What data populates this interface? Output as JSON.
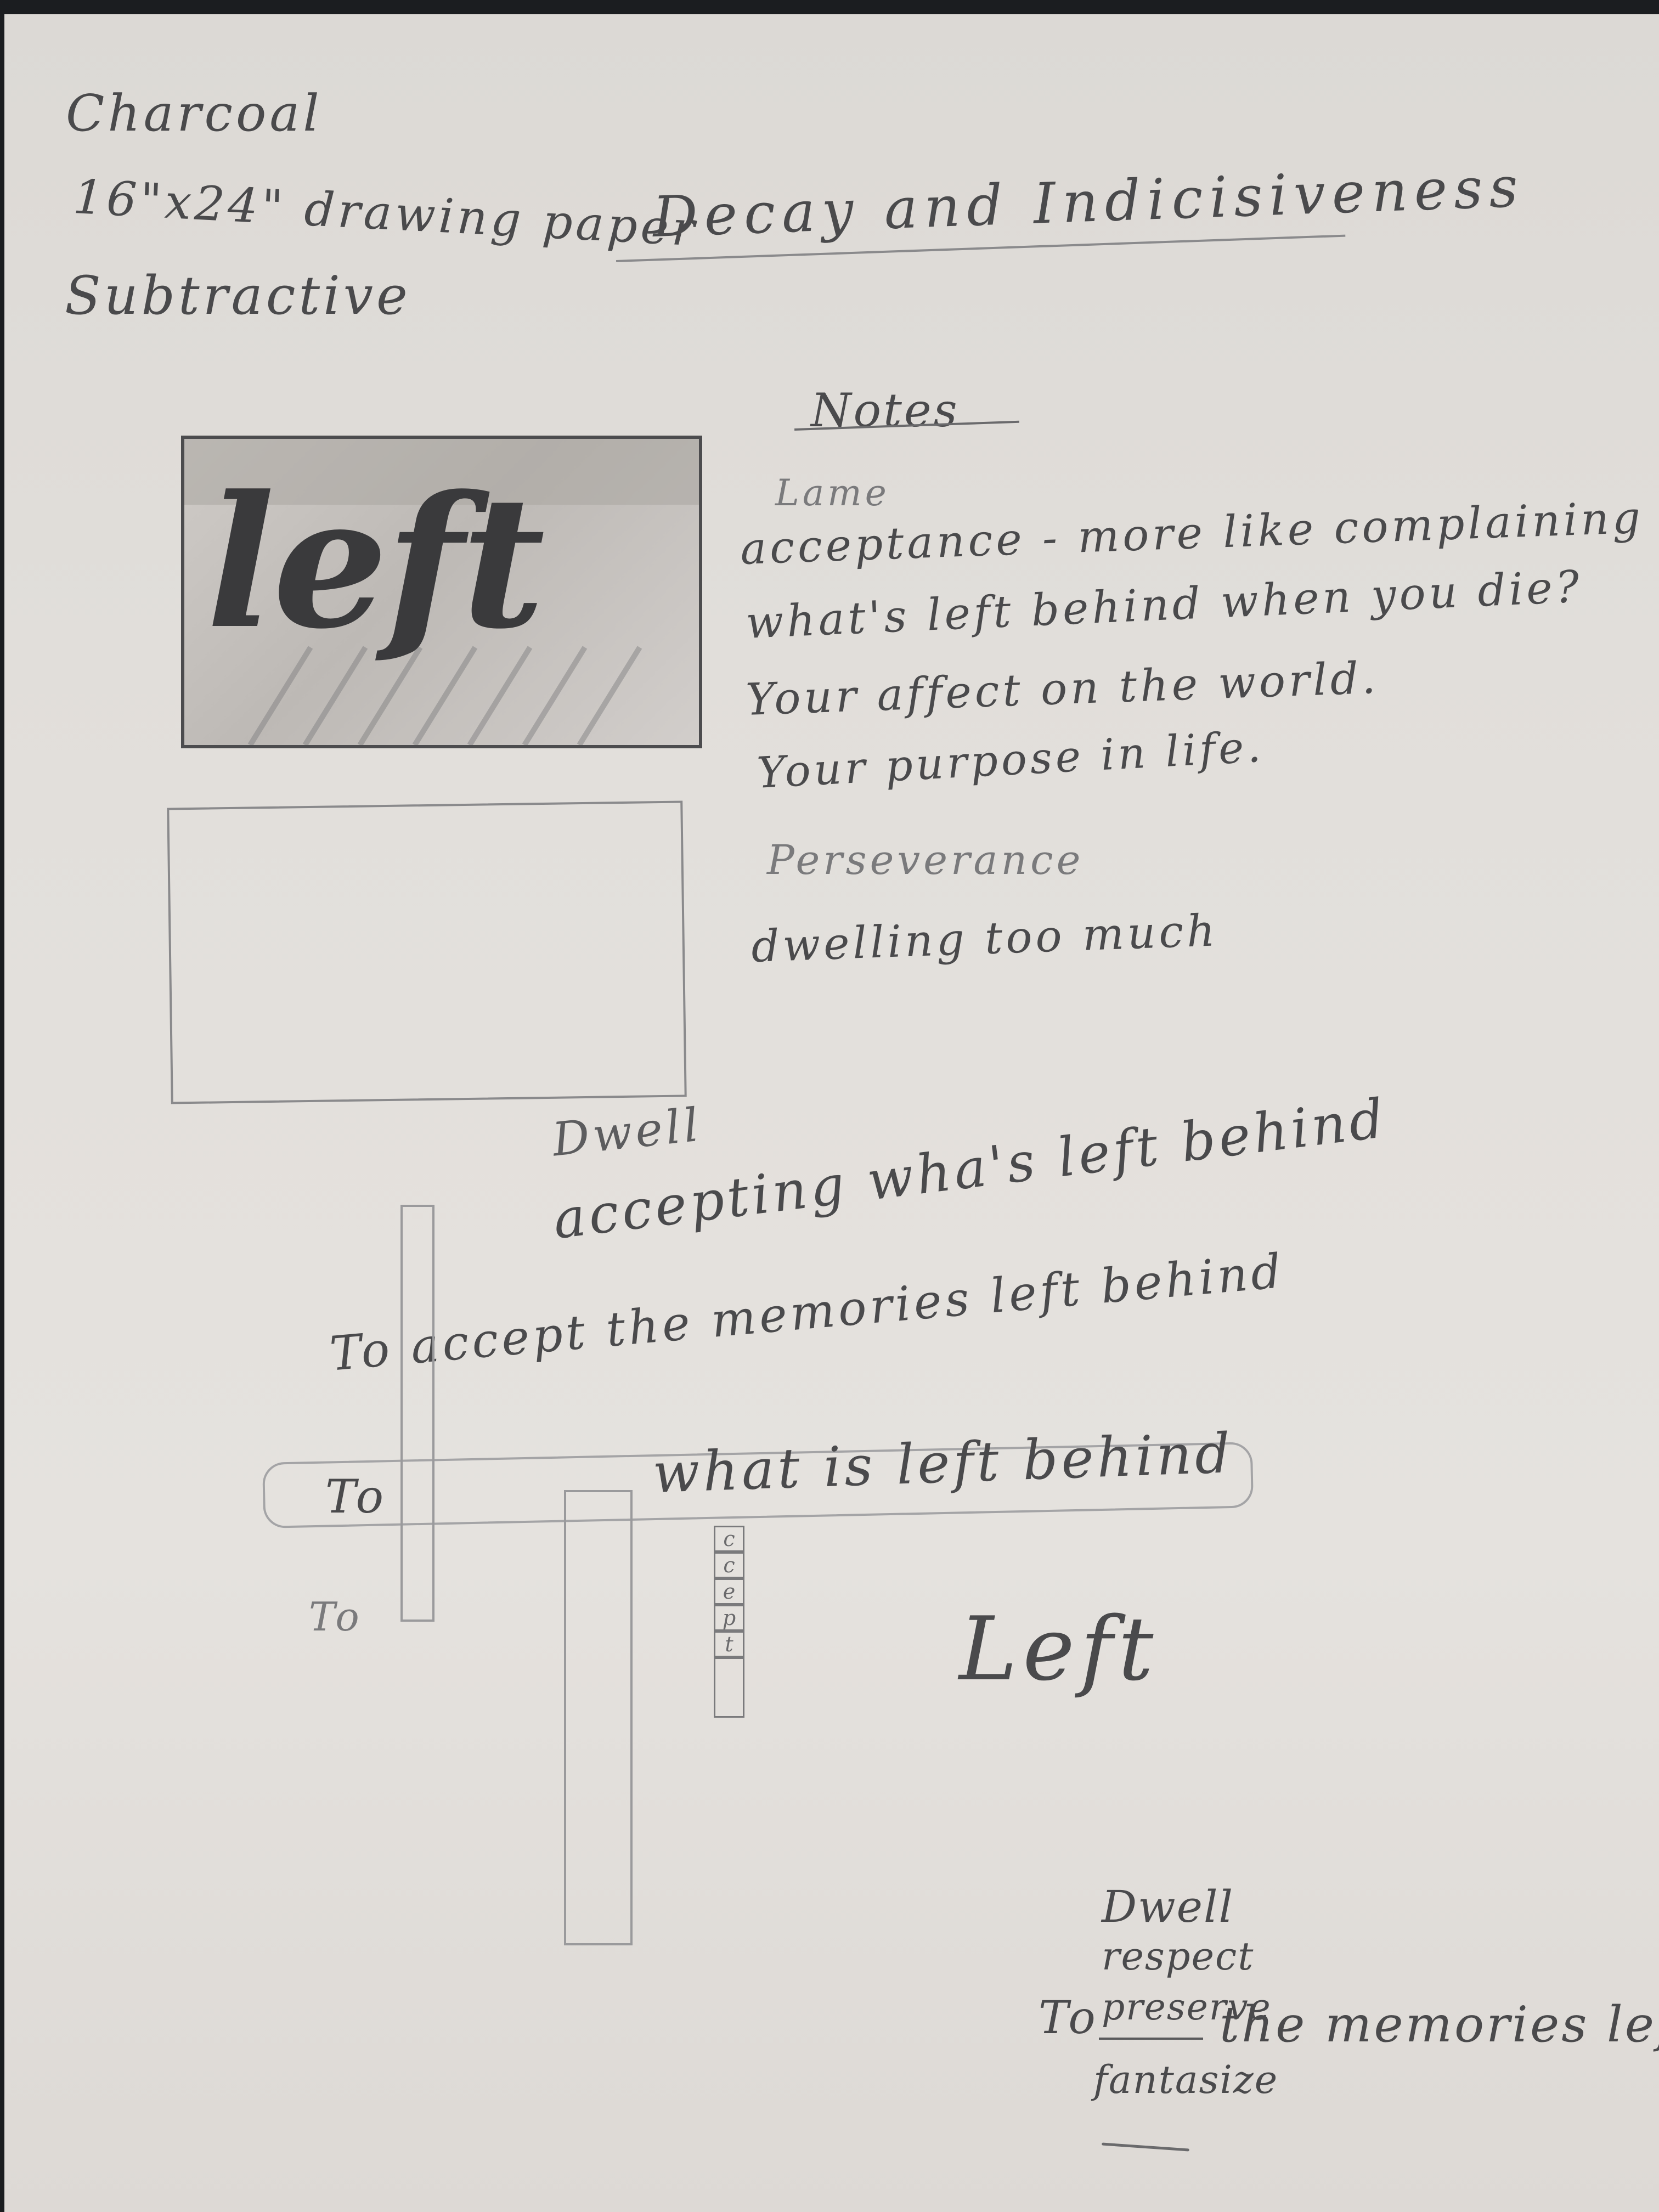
{
  "materials": {
    "medium": "Charcoal",
    "paper": "16\"x24\" drawing paper",
    "method": "Subtractive"
  },
  "title": "Decay and Indicisiveness",
  "notes": {
    "heading": "Notes",
    "lines": [
      "Lame",
      "acceptance - more like complaining",
      "what's left behind when you die?",
      "Your affect on the world.",
      "Your purpose in life.",
      "Perseverance",
      "dwelling too much"
    ]
  },
  "thumbnail": {
    "drawn_word": "left"
  },
  "phrases": {
    "dwell": "Dwell",
    "accepting": "accepting wha's left behind",
    "to_accept": "To accept the memories left behind",
    "to_1": "To",
    "what_is_left_behind": "what is left behind",
    "to_2": "To",
    "left": "Left",
    "to_3": "To",
    "verb_list": [
      "Dwell",
      "respect",
      "preserve",
      "fantasize"
    ],
    "memories_tail": "the memories left beh"
  },
  "vertical_letters": [
    "c",
    "c",
    "e",
    "p",
    "t",
    ""
  ],
  "colors": {
    "paper": "#e2dfdb",
    "graphite": "#4a4a4c",
    "background": "#1b1d20"
  }
}
